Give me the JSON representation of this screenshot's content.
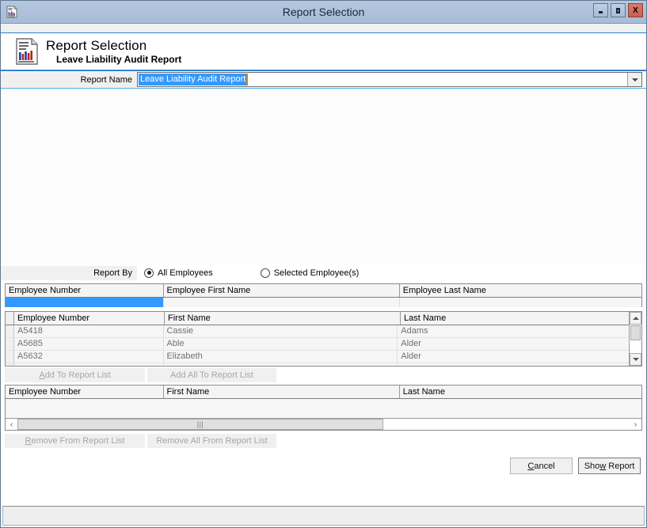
{
  "window": {
    "title": "Report Selection",
    "icon": "report-document-icon",
    "controls": {
      "minimize": "minimize-icon",
      "maximize": "maximize-icon",
      "close": "X"
    }
  },
  "header": {
    "icon": "report-document-icon",
    "title": "Report Selection",
    "subtitle": "Leave Liability Audit Report"
  },
  "report_name": {
    "label": "Report Name",
    "value": "Leave Liability Audit Report",
    "selected": true,
    "dropdown_icon": "chevron-down-icon"
  },
  "report_by": {
    "label": "Report By",
    "options": [
      {
        "label": "All Employees",
        "selected": true
      },
      {
        "label": "Selected Employee(s)",
        "selected": false
      }
    ]
  },
  "filter_grid": {
    "columns": [
      "Employee Number",
      "Employee First Name",
      "Employee Last Name"
    ],
    "filters": [
      "",
      "",
      ""
    ],
    "selected_index": 0
  },
  "available_grid": {
    "columns": [
      "Employee Number",
      "First Name",
      "Last Name"
    ],
    "rows": [
      {
        "number": "A5418",
        "first": "Cassie",
        "last": "Adams"
      },
      {
        "number": "A5685",
        "first": "Able",
        "last": "Alder"
      },
      {
        "number": "A5632",
        "first": "Elizabeth",
        "last": "Alder"
      }
    ],
    "scrollbar": {
      "up_icon": "arrow-up-icon",
      "down_icon": "arrow-down-icon"
    }
  },
  "add_buttons": {
    "add": {
      "pre": "A",
      "accel": "",
      "label_before": "",
      "label": "dd To Report List",
      "full": "Add To Report List",
      "enabled": false
    },
    "add_all": {
      "label": "Add All To Report List",
      "enabled": false
    }
  },
  "selected_grid": {
    "columns": [
      "Employee Number",
      "First Name",
      "Last Name"
    ],
    "rows": [],
    "hscroll": {
      "left_icon": "arrow-left-icon",
      "right_icon": "arrow-right-icon",
      "grip": "‖ "
    }
  },
  "remove_buttons": {
    "remove": {
      "accel": "R",
      "label": "emove From Report List",
      "full": "Remove From Report List",
      "enabled": false
    },
    "remove_all": {
      "label": "Remove All From Report List",
      "enabled": false
    }
  },
  "footer": {
    "cancel": {
      "accel": "C",
      "label": "ancel",
      "full": "Cancel"
    },
    "show_report": {
      "before": "Sho",
      "accel": "w",
      "after": " Report",
      "full": "Show Report"
    }
  },
  "status_bar": {
    "text": ""
  },
  "colors": {
    "title_bar": "#b0c4de",
    "accent_blue": "#2f7fd4",
    "selection_blue": "#3399ff",
    "close_red": "#cc5f4d",
    "disabled_text": "#a6a6a6"
  }
}
